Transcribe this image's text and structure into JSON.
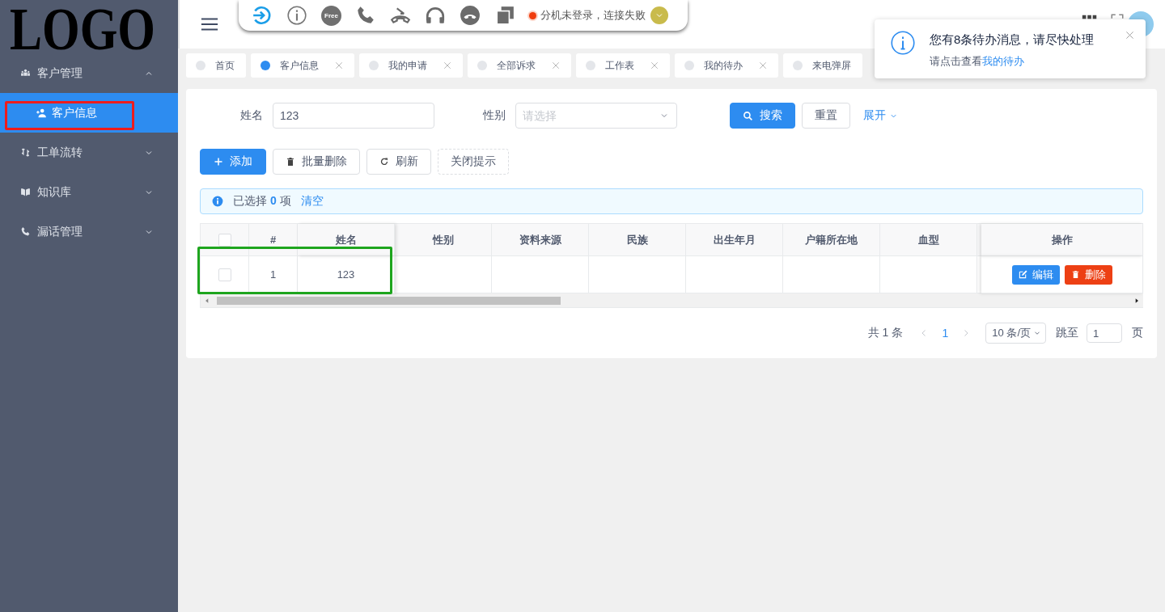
{
  "logo": "LOGO",
  "sidebar": {
    "items": [
      {
        "label": "客户管理",
        "expanded": true,
        "children": [
          {
            "label": "客户信息",
            "selected": true
          }
        ]
      },
      {
        "label": "工单流转",
        "expanded": false
      },
      {
        "label": "知识库",
        "expanded": false
      },
      {
        "label": "漏话管理",
        "expanded": false
      }
    ]
  },
  "softphone": {
    "free_badge": "Free",
    "status": "分机未登录，连接失败"
  },
  "tabs": [
    {
      "label": "首页",
      "selected": false,
      "closable": false
    },
    {
      "label": "客户信息",
      "selected": true,
      "closable": true
    },
    {
      "label": "我的申请",
      "selected": false,
      "closable": true
    },
    {
      "label": "全部诉求",
      "selected": false,
      "closable": true
    },
    {
      "label": "工作表",
      "selected": false,
      "closable": true
    },
    {
      "label": "我的待办",
      "selected": false,
      "closable": true
    },
    {
      "label": "来电弹屏",
      "selected": false,
      "closable": false
    }
  ],
  "search": {
    "name_label": "姓名",
    "name_value": "123",
    "gender_label": "性别",
    "gender_placeholder": "请选择",
    "search_button": "搜索",
    "reset_button": "重置",
    "expand_link": "展开"
  },
  "toolbar": [
    "添加",
    "批量删除",
    "刷新",
    "关闭提示"
  ],
  "selection_alert": {
    "text": "已选择 **0** 项",
    "clear_link": "清空"
  },
  "table": {
    "header_checked": false,
    "columns": [
      "#",
      "姓名",
      "性别",
      "资料来源",
      "民族",
      "出生年月",
      "户籍所在地",
      "血型",
      "操作"
    ],
    "rows": [
      {
        "checked": false,
        "cells": [
          "1",
          "123"
        ],
        "actions": [
          "编辑",
          "删除"
        ]
      }
    ]
  },
  "pagination": {
    "total": "共 1 条",
    "pages": [
      {
        "label": "1",
        "selected": true
      }
    ],
    "page_size": "10 条/页",
    "jump_label": "跳至",
    "jump_value": "1",
    "jump_suffix": "页"
  },
  "notice": {
    "title": "您有8条待办消息，请尽快处理",
    "text": "请点击查看",
    "link": "我的待办"
  },
  "annotations": [
    {
      "color": "#ee1c1c"
    },
    {
      "color": "#1ea51e"
    }
  ]
}
